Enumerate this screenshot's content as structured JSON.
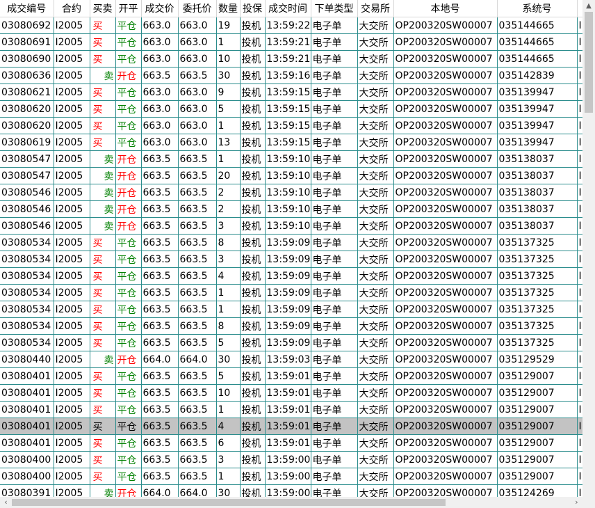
{
  "headers": [
    "成交编号",
    "合约",
    "买卖",
    "开平",
    "成交价",
    "委托价",
    "数量",
    "投保",
    "成交时间",
    "下单类型",
    "交易所",
    "本地号",
    "系统号",
    "…"
  ],
  "rows": [
    {
      "id": "03080692",
      "contract": "I2005",
      "side": "买",
      "oc": "平仓",
      "price": "663.0",
      "order_price": "663.0",
      "qty": "19",
      "hedge": "投机",
      "time": "13:59:22",
      "type": "电子单",
      "exch": "大交所",
      "local": "OP200320SW00007",
      "sys": "035144665",
      "extra": "I"
    },
    {
      "id": "03080691",
      "contract": "I2005",
      "side": "买",
      "oc": "平仓",
      "price": "663.0",
      "order_price": "663.0",
      "qty": "1",
      "hedge": "投机",
      "time": "13:59:21",
      "type": "电子单",
      "exch": "大交所",
      "local": "OP200320SW00007",
      "sys": "035144665",
      "extra": "I"
    },
    {
      "id": "03080690",
      "contract": "I2005",
      "side": "买",
      "oc": "平仓",
      "price": "663.0",
      "order_price": "663.0",
      "qty": "10",
      "hedge": "投机",
      "time": "13:59:21",
      "type": "电子单",
      "exch": "大交所",
      "local": "OP200320SW00007",
      "sys": "035144665",
      "extra": "I"
    },
    {
      "id": "03080636",
      "contract": "I2005",
      "side": "卖",
      "oc": "开仓",
      "price": "663.5",
      "order_price": "663.5",
      "qty": "30",
      "hedge": "投机",
      "time": "13:59:16",
      "type": "电子单",
      "exch": "大交所",
      "local": "OP200320SW00007",
      "sys": "035142839",
      "extra": "I"
    },
    {
      "id": "03080621",
      "contract": "I2005",
      "side": "买",
      "oc": "平仓",
      "price": "663.0",
      "order_price": "663.0",
      "qty": "9",
      "hedge": "投机",
      "time": "13:59:15",
      "type": "电子单",
      "exch": "大交所",
      "local": "OP200320SW00007",
      "sys": "035139947",
      "extra": "I"
    },
    {
      "id": "03080620",
      "contract": "I2005",
      "side": "买",
      "oc": "平仓",
      "price": "663.0",
      "order_price": "663.0",
      "qty": "5",
      "hedge": "投机",
      "time": "13:59:15",
      "type": "电子单",
      "exch": "大交所",
      "local": "OP200320SW00007",
      "sys": "035139947",
      "extra": "I"
    },
    {
      "id": "03080620",
      "contract": "I2005",
      "side": "买",
      "oc": "平仓",
      "price": "663.0",
      "order_price": "663.0",
      "qty": "1",
      "hedge": "投机",
      "time": "13:59:15",
      "type": "电子单",
      "exch": "大交所",
      "local": "OP200320SW00007",
      "sys": "035139947",
      "extra": "I"
    },
    {
      "id": "03080619",
      "contract": "I2005",
      "side": "买",
      "oc": "平仓",
      "price": "663.0",
      "order_price": "663.0",
      "qty": "13",
      "hedge": "投机",
      "time": "13:59:15",
      "type": "电子单",
      "exch": "大交所",
      "local": "OP200320SW00007",
      "sys": "035139947",
      "extra": "I"
    },
    {
      "id": "03080547",
      "contract": "I2005",
      "side": "卖",
      "oc": "开仓",
      "price": "663.5",
      "order_price": "663.5",
      "qty": "1",
      "hedge": "投机",
      "time": "13:59:10",
      "type": "电子单",
      "exch": "大交所",
      "local": "OP200320SW00007",
      "sys": "035138037",
      "extra": "I"
    },
    {
      "id": "03080547",
      "contract": "I2005",
      "side": "卖",
      "oc": "开仓",
      "price": "663.5",
      "order_price": "663.5",
      "qty": "20",
      "hedge": "投机",
      "time": "13:59:10",
      "type": "电子单",
      "exch": "大交所",
      "local": "OP200320SW00007",
      "sys": "035138037",
      "extra": "I"
    },
    {
      "id": "03080546",
      "contract": "I2005",
      "side": "卖",
      "oc": "开仓",
      "price": "663.5",
      "order_price": "663.5",
      "qty": "2",
      "hedge": "投机",
      "time": "13:59:10",
      "type": "电子单",
      "exch": "大交所",
      "local": "OP200320SW00007",
      "sys": "035138037",
      "extra": "I"
    },
    {
      "id": "03080546",
      "contract": "I2005",
      "side": "卖",
      "oc": "开仓",
      "price": "663.5",
      "order_price": "663.5",
      "qty": "2",
      "hedge": "投机",
      "time": "13:59:10",
      "type": "电子单",
      "exch": "大交所",
      "local": "OP200320SW00007",
      "sys": "035138037",
      "extra": "I"
    },
    {
      "id": "03080546",
      "contract": "I2005",
      "side": "卖",
      "oc": "开仓",
      "price": "663.5",
      "order_price": "663.5",
      "qty": "3",
      "hedge": "投机",
      "time": "13:59:10",
      "type": "电子单",
      "exch": "大交所",
      "local": "OP200320SW00007",
      "sys": "035138037",
      "extra": "I"
    },
    {
      "id": "03080534",
      "contract": "I2005",
      "side": "买",
      "oc": "平仓",
      "price": "663.5",
      "order_price": "663.5",
      "qty": "8",
      "hedge": "投机",
      "time": "13:59:09",
      "type": "电子单",
      "exch": "大交所",
      "local": "OP200320SW00007",
      "sys": "035137325",
      "extra": "I"
    },
    {
      "id": "03080534",
      "contract": "I2005",
      "side": "买",
      "oc": "平仓",
      "price": "663.5",
      "order_price": "663.5",
      "qty": "3",
      "hedge": "投机",
      "time": "13:59:09",
      "type": "电子单",
      "exch": "大交所",
      "local": "OP200320SW00007",
      "sys": "035137325",
      "extra": "I"
    },
    {
      "id": "03080534",
      "contract": "I2005",
      "side": "买",
      "oc": "平仓",
      "price": "663.5",
      "order_price": "663.5",
      "qty": "4",
      "hedge": "投机",
      "time": "13:59:09",
      "type": "电子单",
      "exch": "大交所",
      "local": "OP200320SW00007",
      "sys": "035137325",
      "extra": "I"
    },
    {
      "id": "03080534",
      "contract": "I2005",
      "side": "买",
      "oc": "平仓",
      "price": "663.5",
      "order_price": "663.5",
      "qty": "1",
      "hedge": "投机",
      "time": "13:59:09",
      "type": "电子单",
      "exch": "大交所",
      "local": "OP200320SW00007",
      "sys": "035137325",
      "extra": "I"
    },
    {
      "id": "03080534",
      "contract": "I2005",
      "side": "买",
      "oc": "平仓",
      "price": "663.5",
      "order_price": "663.5",
      "qty": "1",
      "hedge": "投机",
      "time": "13:59:09",
      "type": "电子单",
      "exch": "大交所",
      "local": "OP200320SW00007",
      "sys": "035137325",
      "extra": "I"
    },
    {
      "id": "03080534",
      "contract": "I2005",
      "side": "买",
      "oc": "平仓",
      "price": "663.5",
      "order_price": "663.5",
      "qty": "8",
      "hedge": "投机",
      "time": "13:59:09",
      "type": "电子单",
      "exch": "大交所",
      "local": "OP200320SW00007",
      "sys": "035137325",
      "extra": "I"
    },
    {
      "id": "03080534",
      "contract": "I2005",
      "side": "买",
      "oc": "平仓",
      "price": "663.5",
      "order_price": "663.5",
      "qty": "5",
      "hedge": "投机",
      "time": "13:59:09",
      "type": "电子单",
      "exch": "大交所",
      "local": "OP200320SW00007",
      "sys": "035137325",
      "extra": "I"
    },
    {
      "id": "03080440",
      "contract": "I2005",
      "side": "卖",
      "oc": "开仓",
      "price": "664.0",
      "order_price": "664.0",
      "qty": "30",
      "hedge": "投机",
      "time": "13:59:03",
      "type": "电子单",
      "exch": "大交所",
      "local": "OP200320SW00007",
      "sys": "035129529",
      "extra": "I"
    },
    {
      "id": "03080401",
      "contract": "I2005",
      "side": "买",
      "oc": "平仓",
      "price": "663.5",
      "order_price": "663.5",
      "qty": "5",
      "hedge": "投机",
      "time": "13:59:01",
      "type": "电子单",
      "exch": "大交所",
      "local": "OP200320SW00007",
      "sys": "035129007",
      "extra": "I"
    },
    {
      "id": "03080401",
      "contract": "I2005",
      "side": "买",
      "oc": "平仓",
      "price": "663.5",
      "order_price": "663.5",
      "qty": "10",
      "hedge": "投机",
      "time": "13:59:01",
      "type": "电子单",
      "exch": "大交所",
      "local": "OP200320SW00007",
      "sys": "035129007",
      "extra": "I"
    },
    {
      "id": "03080401",
      "contract": "I2005",
      "side": "买",
      "oc": "平仓",
      "price": "663.5",
      "order_price": "663.5",
      "qty": "1",
      "hedge": "投机",
      "time": "13:59:01",
      "type": "电子单",
      "exch": "大交所",
      "local": "OP200320SW00007",
      "sys": "035129007",
      "extra": "I"
    },
    {
      "id": "03080401",
      "contract": "I2005",
      "side": "买",
      "oc": "平仓",
      "price": "663.5",
      "order_price": "663.5",
      "qty": "4",
      "hedge": "投机",
      "time": "13:59:01",
      "type": "电子单",
      "exch": "大交所",
      "local": "OP200320SW00007",
      "sys": "035129007",
      "extra": "I",
      "selected": true
    },
    {
      "id": "03080401",
      "contract": "I2005",
      "side": "买",
      "oc": "平仓",
      "price": "663.5",
      "order_price": "663.5",
      "qty": "6",
      "hedge": "投机",
      "time": "13:59:01",
      "type": "电子单",
      "exch": "大交所",
      "local": "OP200320SW00007",
      "sys": "035129007",
      "extra": "I"
    },
    {
      "id": "03080400",
      "contract": "I2005",
      "side": "买",
      "oc": "平仓",
      "price": "663.5",
      "order_price": "663.5",
      "qty": "3",
      "hedge": "投机",
      "time": "13:59:00",
      "type": "电子单",
      "exch": "大交所",
      "local": "OP200320SW00007",
      "sys": "035129007",
      "extra": "I"
    },
    {
      "id": "03080400",
      "contract": "I2005",
      "side": "买",
      "oc": "平仓",
      "price": "663.5",
      "order_price": "663.5",
      "qty": "1",
      "hedge": "投机",
      "time": "13:59:00",
      "type": "电子单",
      "exch": "大交所",
      "local": "OP200320SW00007",
      "sys": "035129007",
      "extra": "I"
    },
    {
      "id": "03080391",
      "contract": "I2005",
      "side": "卖",
      "oc": "开仓",
      "price": "664.0",
      "order_price": "664.0",
      "qty": "30",
      "hedge": "投机",
      "time": "13:59:00",
      "type": "电子单",
      "exch": "大交所",
      "local": "OP200320SW00007",
      "sys": "035124269",
      "extra": "I"
    }
  ],
  "scroll": {
    "up_arrow_icon": "up-arrow-icon",
    "left_arrow_icon": "left-arrow-icon",
    "right_arrow_icon": "right-arrow-icon"
  }
}
